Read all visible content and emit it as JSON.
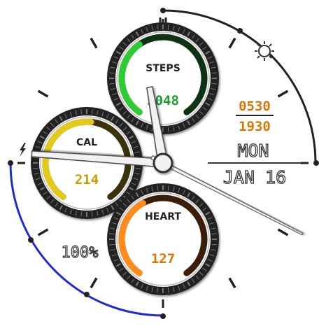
{
  "watch": {
    "sunrise": "0530",
    "sunset": "1930",
    "day": "MON",
    "date": "JAN 16",
    "battery": "100%",
    "charging_icon": "bolt-icon",
    "sun_icon": "sun-icon"
  },
  "complications": [
    {
      "key": "steps",
      "label": "STEPS",
      "value": "3048",
      "fraction": 0.38,
      "color": "#2ecc33",
      "dark": "#0d3313",
      "value_color": "#1aa02a"
    },
    {
      "key": "cal",
      "label": "CAL",
      "value": "214",
      "fraction": 0.52,
      "color": "#e3c91a",
      "dark": "#3a320a",
      "value_color": "#c8a000"
    },
    {
      "key": "heart",
      "label": "HEART",
      "value": "127",
      "fraction": 0.4,
      "color": "#ff8c1a",
      "dark": "#3a1e0a",
      "value_color": "#d97706"
    }
  ],
  "arcs": {
    "sun_arc_color": "#222222",
    "battery_arc_color": "#1c2bd6",
    "battery_fraction": 1.0
  },
  "hands": {
    "hour_angle_deg": -10,
    "minute_angle_deg": -86,
    "second_angle_deg": 117
  }
}
